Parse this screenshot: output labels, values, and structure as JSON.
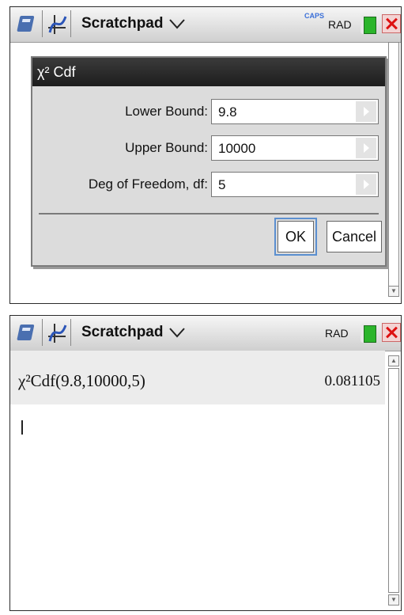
{
  "top_screen": {
    "tabbar": {
      "title": "Scratchpad",
      "caps": "CAPS",
      "mode": "RAD"
    },
    "dialog": {
      "title": "χ² Cdf",
      "fields": [
        {
          "label": "Lower Bound:",
          "value": "9.8"
        },
        {
          "label": "Upper Bound:",
          "value": "10000"
        },
        {
          "label": "Deg of Freedom, df:",
          "value": "5"
        }
      ],
      "ok_label": "OK",
      "cancel_label": "Cancel"
    }
  },
  "bottom_screen": {
    "tabbar": {
      "title": "Scratchpad",
      "mode": "RAD"
    },
    "history": {
      "expression": "χ²Cdf(9.8,10000,5)",
      "result": "0.081105"
    }
  },
  "colors": {
    "accent_blue": "#5b8fd0",
    "battery_green": "#2bb52b",
    "close_red": "#d11111"
  }
}
